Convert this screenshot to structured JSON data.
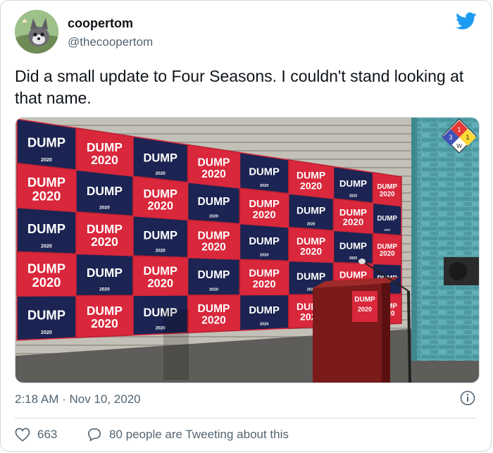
{
  "author": {
    "display_name": "coopertom",
    "handle": "@thecoopertom"
  },
  "tweet": {
    "text": "Did a small update to Four Seasons. I couldn't stand looking at that name."
  },
  "media": {
    "sign_word": "DUMP",
    "sign_year": "2020",
    "podium_word": "DUMP",
    "podium_year": "2020",
    "placard_numbers": [
      "3",
      "1",
      "1",
      "W"
    ],
    "colors": {
      "sign_red": "#d9273b",
      "sign_navy": "#1b2452",
      "wall": "#b9b6ae",
      "brick_teal": "#4f9fa8",
      "podium": "#7a1a1a"
    }
  },
  "meta": {
    "timestamp": "2:18 AM · Nov 10, 2020"
  },
  "actions": {
    "like_count": "663",
    "reply_text": "80 people are Tweeting about this"
  },
  "icons": {
    "brand": "twitter-bird-icon",
    "info": "info-icon",
    "like": "heart-icon",
    "reply": "speech-bubble-icon"
  },
  "theme": {
    "twitter_blue": "#1d9bf0",
    "text_primary": "#0f1419",
    "text_secondary": "#536471",
    "border": "#cfd9de"
  }
}
